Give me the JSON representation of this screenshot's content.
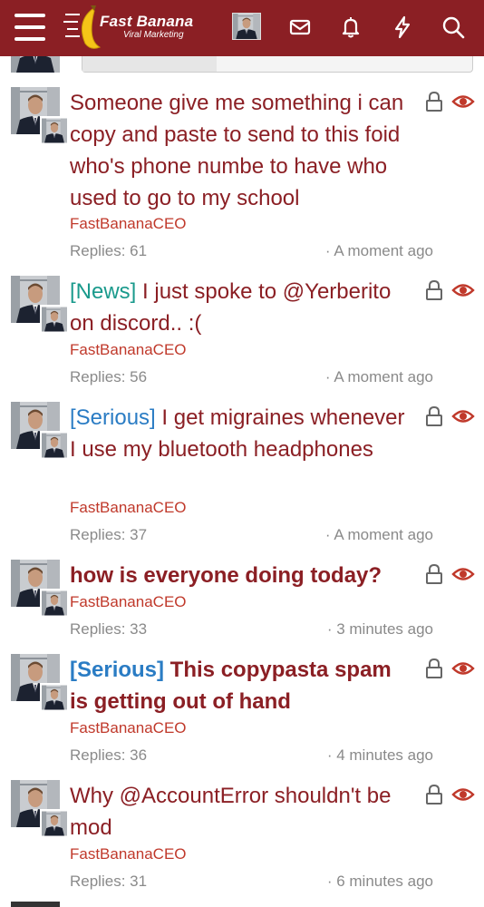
{
  "header": {
    "logo_title": "Fast Banana",
    "logo_subtitle": "Viral Marketing",
    "icons": [
      "menu-icon",
      "mail-icon",
      "bell-icon",
      "lightning-icon",
      "search-icon"
    ]
  },
  "colors": {
    "header_bg": "#8b1f24",
    "title": "#8b1f24",
    "author": "#c0392b",
    "prefix_news": "#1a9a8c",
    "prefix_serious": "#2a7cc4",
    "meta": "#8a8a8a"
  },
  "threads": [
    {
      "prefix": "",
      "title": "Someone give me something i can copy and paste to send to this foid who's phone numbe to have who used to go to my school",
      "bold": false,
      "author": "FastBananaCEO",
      "replies": "Replies: 61",
      "time": "· A moment ago"
    },
    {
      "prefix": "[News]",
      "title": " I just spoke to @Yerberito on discord.. :(",
      "bold": false,
      "author": "FastBananaCEO",
      "replies": "Replies: 56",
      "time": "· A moment ago"
    },
    {
      "prefix": "[Serious]",
      "title": " I get migraines whenever I use my bluetooth headphones",
      "bold": false,
      "author": "FastBananaCEO",
      "replies": "Replies: 37",
      "time": "· A moment ago"
    },
    {
      "prefix": "",
      "title": "how is everyone doing today?",
      "bold": true,
      "author": "FastBananaCEO",
      "replies": "Replies: 33",
      "time": "· 3 minutes ago"
    },
    {
      "prefix": "[Serious]",
      "title": " This copypasta spam is getting out of hand",
      "bold": true,
      "author": "FastBananaCEO",
      "replies": "Replies: 36",
      "time": "· 4 minutes ago"
    },
    {
      "prefix": "",
      "title": "Why @AccountError shouldn't be mod",
      "bold": false,
      "author": "FastBananaCEO",
      "replies": "Replies: 31",
      "time": "· 6 minutes ago"
    }
  ]
}
